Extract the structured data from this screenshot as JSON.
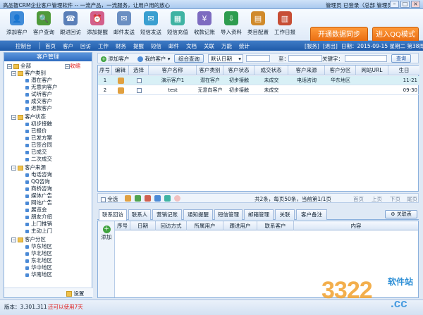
{
  "window": {
    "title": "高品智CRM企业客户管理软件 -- 一流产品，一流服务，让用户用的放心",
    "user_role": "管理员",
    "login_status": "已登录（总部 管理员）"
  },
  "toolbar": {
    "buttons": [
      {
        "label": "添加客户",
        "icon": "add-customer-icon"
      },
      {
        "label": "客户查询",
        "icon": "customer-search-icon"
      },
      {
        "label": "跟进回访",
        "icon": "followup-icon"
      },
      {
        "label": "添加提醒",
        "icon": "reminder-icon"
      },
      {
        "label": "邮件发送",
        "icon": "mail-icon"
      },
      {
        "label": "短信发送",
        "icon": "sms-icon"
      },
      {
        "label": "短信充值",
        "icon": "recharge-icon"
      },
      {
        "label": "收款记账",
        "icon": "payment-icon"
      },
      {
        "label": "导入资料",
        "icon": "import-icon"
      },
      {
        "label": "类目配置",
        "icon": "category-config-icon"
      },
      {
        "label": "工作日报",
        "icon": "daily-report-icon"
      }
    ],
    "sync_button": "开通数据同步",
    "qq_button": "进入QQ模式"
  },
  "nav": {
    "items": [
      "控制台",
      "首页",
      "客户",
      "回访",
      "工作",
      "财务",
      "提醒",
      "短信",
      "邮件",
      "文档",
      "关联",
      "万能",
      "统计"
    ],
    "service": "[服务]",
    "logout": "[退出]",
    "date": "日期：2015-09-15 星期二 第38周"
  },
  "sidebar": {
    "header": "客户管理",
    "collapse": "收缩",
    "root": "全部",
    "groups": [
      {
        "label": "客户类别",
        "items": [
          "潜在客户",
          "无意向客户",
          "试听客户",
          "成交客户",
          "退款客户"
        ]
      },
      {
        "label": "客户状态",
        "items": [
          "初步接触",
          "已报价",
          "已发方案",
          "已签合同",
          "已成交",
          "二次成交"
        ]
      },
      {
        "label": "客户来源",
        "items": [
          "电话咨询",
          "QQ咨询",
          "商桥咨询",
          "媒体广告",
          "网站广告",
          "展览会",
          "朋友介绍",
          "上门推销",
          "主动上门"
        ]
      },
      {
        "label": "客户分区",
        "items": [
          "华东地区",
          "华北地区",
          "东北地区",
          "华中地区",
          "华南地区"
        ]
      }
    ],
    "settings": "设置"
  },
  "filter": {
    "add_customer": "添加客户",
    "my_customers": "我的客户",
    "combined_search": "综合查询",
    "date_select": "默认日期",
    "to_label": "至：",
    "keyword_label": "关键字：",
    "search_button": "查询"
  },
  "grid": {
    "columns": [
      "序号",
      "编辑",
      "选择",
      "客户名称",
      "客户类别",
      "客户状态",
      "成交状态",
      "客户来源",
      "客户分区",
      "网站URL",
      "生日"
    ],
    "rows": [
      {
        "no": "1",
        "name": "演示客户1",
        "category": "潜在客户",
        "status": "初步接触",
        "deal": "未成交",
        "source": "电话咨询",
        "region": "华东地区",
        "url": "",
        "birthday": "11-21"
      },
      {
        "no": "2",
        "name": "test",
        "category": "无意向客户",
        "status": "初步接触",
        "deal": "未成交",
        "source": "",
        "region": "",
        "url": "",
        "birthday": "09-30"
      }
    ]
  },
  "pager": {
    "select_all": "全选",
    "summary": "共2条，每页50条，当前第1/1页",
    "first": "首页",
    "prev": "上页",
    "next": "下页",
    "last": "尾页"
  },
  "subtabs": {
    "tabs": [
      "联系回访",
      "联系人",
      "营销记账",
      "通知提醒",
      "短信管理",
      "邮箱管理",
      "关联",
      "客户备注"
    ],
    "close_button": "关联表",
    "add_label": "添加",
    "columns": [
      "序号",
      "日期",
      "回访方式",
      "所属用户",
      "跟进用户",
      "联系客户",
      "内容"
    ]
  },
  "status": {
    "version": "版本：3.301.311",
    "remaining": "还可以使用7天"
  },
  "watermark": {
    "text": "3322",
    "suffix": ".cc",
    "site": "软件站"
  },
  "colors": {
    "accent": "#2f6cc0",
    "selected_row": "#d8f0f6",
    "orange": "#e86b10",
    "warn_text": "#e02020"
  }
}
